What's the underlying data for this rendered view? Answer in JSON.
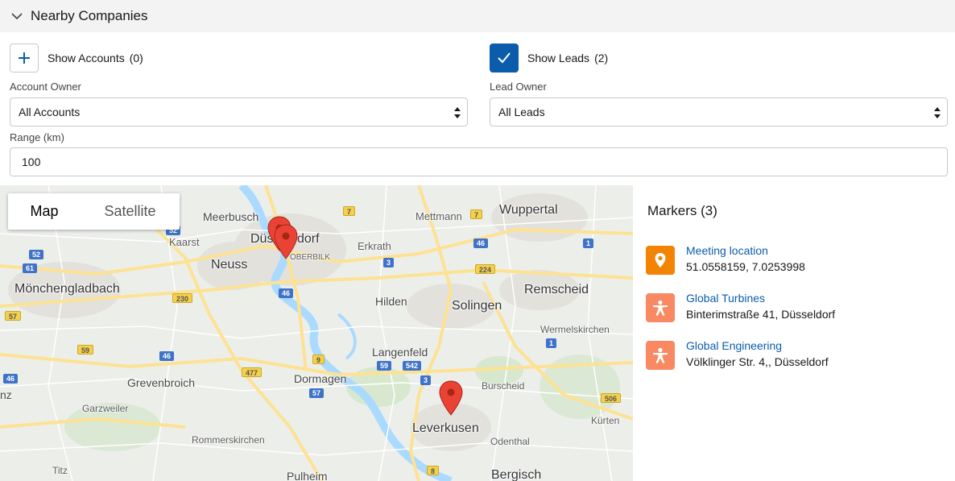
{
  "header": {
    "title": "Nearby Companies",
    "icon": "chevron-down-icon"
  },
  "accounts": {
    "toggle_label": "Show Accounts",
    "toggle_count": "(0)",
    "checked": false,
    "owner_label": "Account Owner",
    "owner_value": "All Accounts"
  },
  "leads": {
    "toggle_label": "Show Leads",
    "toggle_count": "(2)",
    "checked": true,
    "owner_label": "Lead Owner",
    "owner_value": "All Leads"
  },
  "range": {
    "label": "Range (km)",
    "value": "100"
  },
  "map": {
    "type_buttons": {
      "map": "Map",
      "satellite": "Satellite"
    },
    "places": {
      "meerbusch": "Meerbusch",
      "duesseldorf_a": "Düs",
      "duesseldorf_b": "dorf",
      "oberbilk": "OBERBILK",
      "erkrath": "Erkrath",
      "mettmann": "Mettmann",
      "wuppertal": "Wuppertal",
      "kaarst": "Kaarst",
      "neuss": "Neuss",
      "moenchengladbach": "Mönchengladbach",
      "hilden": "Hilden",
      "solingen": "Solingen",
      "remscheid": "Remscheid",
      "wermelskirchen": "Wermelskirchen",
      "langenfeld": "Langenfeld",
      "grevenbroich": "Grevenbroich",
      "dormagen": "Dormagen",
      "burscheid": "Burscheid",
      "garzweiler": "Garzweiler",
      "leverkusen": "Leverkusen",
      "kuerten": "Kürten",
      "rommerskirchen": "Rommerskirchen",
      "odenthal": "Odenthal",
      "titz": "Titz",
      "pulheim": "Pulheim",
      "bergisch": "Bergisch",
      "nz": "nz"
    },
    "road_shields": {
      "r52a": "52",
      "r52b": "52",
      "r61": "61",
      "r57": "57",
      "r59": "59",
      "r46a": "46",
      "r46b": "46",
      "r46c": "46",
      "r46d": "46",
      "r3a": "3",
      "r3b": "3",
      "r1a": "1",
      "r1b": "1",
      "r7a": "7",
      "r7b": "7",
      "r224": "224",
      "r230": "230",
      "r9": "9",
      "r477": "477",
      "r59b": "59",
      "r542": "542",
      "r57b": "57",
      "r506": "506",
      "r8": "8"
    }
  },
  "markers": {
    "heading": "Markers (3)",
    "items": [
      {
        "name": "Meeting location",
        "detail": "51.0558159, 7.0253998",
        "icon": "location-pin-icon",
        "color": "#f38303"
      },
      {
        "name": "Global Turbines",
        "detail": "Binterimstraße 41, Düsseldorf",
        "icon": "lead-person-icon",
        "color": "#f88962"
      },
      {
        "name": "Global Engineering",
        "detail": "Völklinger Str. 4,, Düsseldorf",
        "icon": "lead-person-icon",
        "color": "#f88962"
      }
    ]
  },
  "colors": {
    "accent": "#0b5cab",
    "pin": "#ea4335",
    "meeting": "#f38303",
    "lead": "#f88962"
  }
}
